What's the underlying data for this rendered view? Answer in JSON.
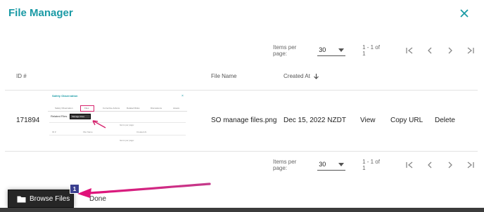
{
  "dialog": {
    "title": "File Manager",
    "close_icon": "close-icon"
  },
  "pager": {
    "items_label": "Items per page:",
    "per_page": "30",
    "range": "1 - 1 of 1"
  },
  "table": {
    "headers": {
      "id": "ID #",
      "file_name": "File Name",
      "created_at": "Created At"
    },
    "rows": [
      {
        "id": "171894",
        "file_name": "SO manage files.png",
        "created_at": "Dec 15, 2022 NZDT",
        "actions": [
          "View",
          "Copy URL",
          "Delete"
        ]
      }
    ]
  },
  "thumbnail": {
    "title": "Safety Observation",
    "close": "×",
    "tabs": [
      "Safety Observation",
      "Files",
      "Corrective Actions",
      "Related Risks",
      "Discussions",
      "Assets"
    ],
    "heading": "Related Files",
    "button": "Manage Files",
    "small_texts": [
      "Items per page:",
      "ID #",
      "File Name",
      "Created At"
    ]
  },
  "footer": {
    "browse_label": "Browse Files",
    "badge": "1",
    "done_label": "Done"
  },
  "colors": {
    "accent": "#1a9aa5",
    "arrow": "#d6246e",
    "button_bg": "#262626",
    "badge_bg": "#3a3f8f"
  }
}
